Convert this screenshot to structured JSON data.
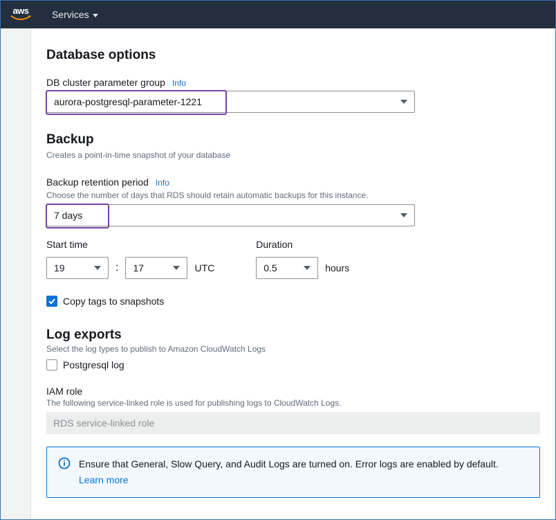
{
  "nav": {
    "services_label": "Services"
  },
  "section1": {
    "title": "Database options",
    "pg_label": "DB cluster parameter group",
    "pg_info": "Info",
    "pg_value": "aurora-postgresql-parameter-1221"
  },
  "backup": {
    "title": "Backup",
    "subtitle": "Creates a point-in-time snapshot of your database",
    "retention_label": "Backup retention period",
    "retention_info": "Info",
    "retention_hint": "Choose the number of days that RDS should retain automatic backups for this instance.",
    "retention_value": "7 days",
    "start_label": "Start time",
    "start_hour": "19",
    "start_minute": "17",
    "tz": "UTC",
    "duration_label": "Duration",
    "duration_value": "0.5",
    "duration_unit": "hours",
    "copy_tags_label": "Copy tags to snapshots",
    "copy_tags_checked": true
  },
  "logexports": {
    "title": "Log exports",
    "hint": "Select the log types to publish to Amazon CloudWatch Logs",
    "pg_log_label": "Postgresql log",
    "pg_log_checked": false,
    "iam_label": "IAM role",
    "iam_hint": "The following service-linked role is used for publishing logs to CloudWatch Logs.",
    "iam_value": "RDS service-linked role"
  },
  "alert": {
    "message": "Ensure that General, Slow Query, and Audit Logs are turned on. Error logs are enabled by default.",
    "learn_more": "Learn more"
  }
}
